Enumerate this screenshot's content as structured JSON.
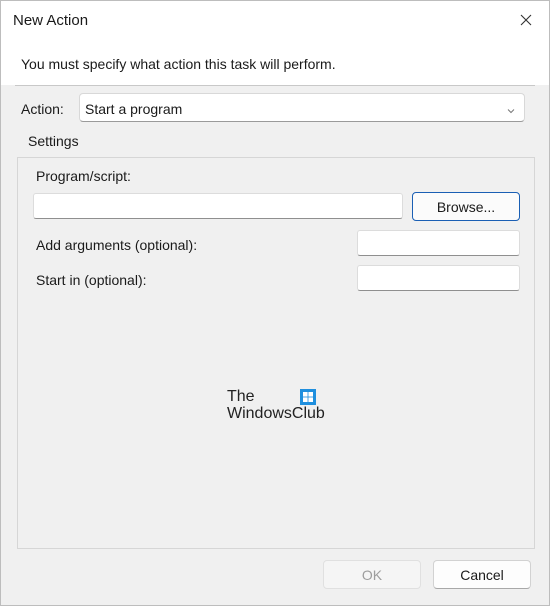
{
  "window": {
    "title": "New Action",
    "message": "You must specify what action this task will perform."
  },
  "action": {
    "label": "Action:",
    "selected": "Start a program"
  },
  "settings": {
    "label": "Settings",
    "program_label": "Program/script:",
    "program_value": "",
    "browse_label": "Browse...",
    "arguments_label": "Add arguments (optional):",
    "arguments_value": "",
    "start_in_label": "Start in (optional):",
    "start_in_value": ""
  },
  "watermark": {
    "line1": "The",
    "line2": "WindowsClub"
  },
  "footer": {
    "ok_label": "OK",
    "cancel_label": "Cancel"
  },
  "icons": {
    "close": "close-icon",
    "dropdown": "chevron-down-icon",
    "logo": "windows-logo-icon"
  },
  "colors": {
    "accent": "#1a5fb4",
    "dialog_bg": "#f0f0f0",
    "logo": "#1f8fde"
  }
}
